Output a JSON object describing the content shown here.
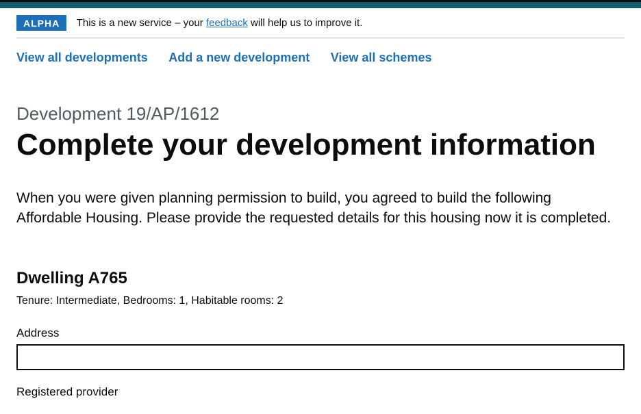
{
  "phase": {
    "tag": "ALPHA",
    "prefix": "This is a new service – your ",
    "link_text": "feedback",
    "suffix": " will help us to improve it."
  },
  "nav": {
    "view_dev": "View all developments",
    "add_dev": "Add a new development",
    "view_schemes": "View all schemes"
  },
  "page": {
    "caption": "Development 19/AP/1612",
    "title": "Complete your development information",
    "lede": "When you were given planning permission to build, you agreed to build the following Affordable Housing. Please provide the requested details for this housing now it is completed."
  },
  "dwelling": {
    "heading": "Dwelling A765",
    "meta": "Tenure: Intermediate, Bedrooms: 1, Habitable rooms: 2"
  },
  "form": {
    "address_label": "Address",
    "address_value": "",
    "provider_label": "Registered provider"
  }
}
